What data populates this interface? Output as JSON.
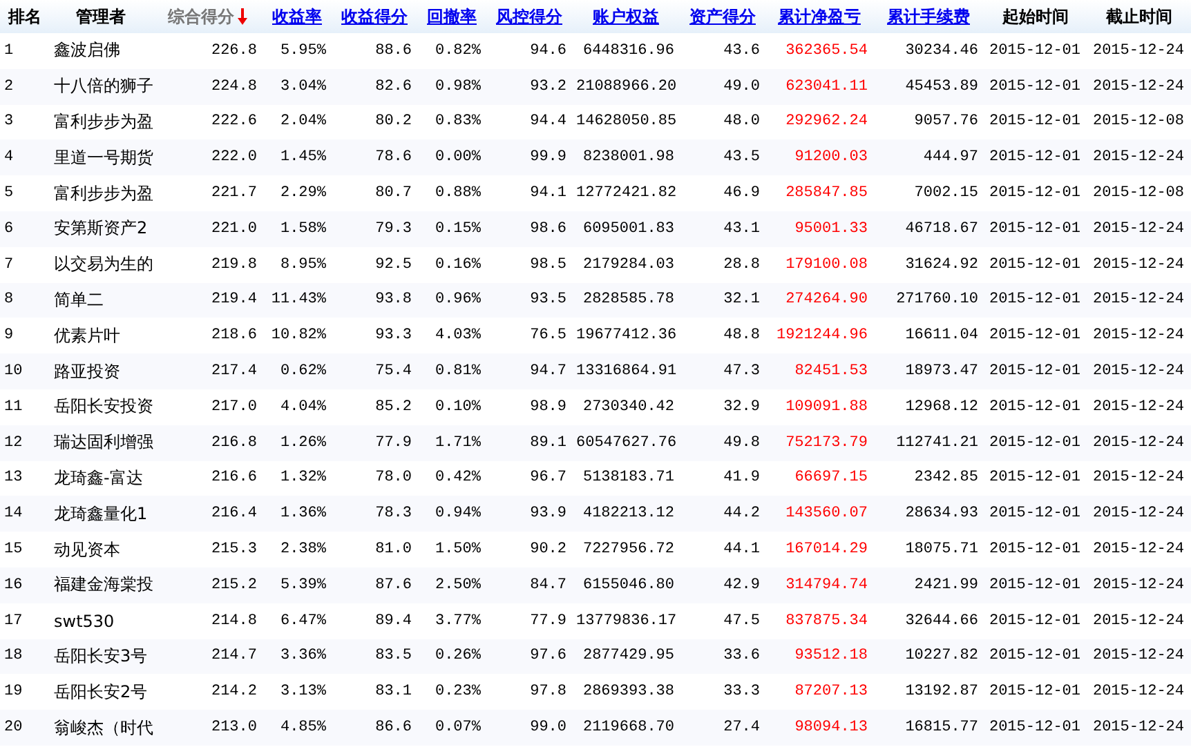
{
  "table": {
    "columns": [
      {
        "label": "排名",
        "kind": "plain"
      },
      {
        "label": "管理者",
        "kind": "plain"
      },
      {
        "label": "综合得分",
        "kind": "sorted"
      },
      {
        "label": "收益率",
        "kind": "link"
      },
      {
        "label": "收益得分",
        "kind": "link"
      },
      {
        "label": "回撤率",
        "kind": "link"
      },
      {
        "label": "风控得分",
        "kind": "link"
      },
      {
        "label": "账户权益",
        "kind": "link"
      },
      {
        "label": "资产得分",
        "kind": "link"
      },
      {
        "label": "累计净盈亏",
        "kind": "link",
        "color": "#ff0000"
      },
      {
        "label": "累计手续费",
        "kind": "link"
      },
      {
        "label": "起始时间",
        "kind": "plain"
      },
      {
        "label": "截止时间",
        "kind": "plain"
      }
    ],
    "rows": [
      [
        "1",
        "鑫波启佛",
        "226.8",
        "5.95%",
        "88.6",
        "0.82%",
        "94.6",
        "6448316.96",
        "43.6",
        "362365.54",
        "30234.46",
        "2015-12-01",
        "2015-12-24"
      ],
      [
        "2",
        "十八倍的狮子",
        "224.8",
        "3.04%",
        "82.6",
        "0.98%",
        "93.2",
        "21088966.20",
        "49.0",
        "623041.11",
        "45453.89",
        "2015-12-01",
        "2015-12-24"
      ],
      [
        "3",
        "富利步步为盈",
        "222.6",
        "2.04%",
        "80.2",
        "0.83%",
        "94.4",
        "14628050.85",
        "48.0",
        "292962.24",
        "9057.76",
        "2015-12-01",
        "2015-12-08"
      ],
      [
        "4",
        "里道一号期货",
        "222.0",
        "1.45%",
        "78.6",
        "0.00%",
        "99.9",
        "8238001.98",
        "43.5",
        "91200.03",
        "444.97",
        "2015-12-01",
        "2015-12-24"
      ],
      [
        "5",
        "富利步步为盈",
        "221.7",
        "2.29%",
        "80.7",
        "0.88%",
        "94.1",
        "12772421.82",
        "46.9",
        "285847.85",
        "7002.15",
        "2015-12-01",
        "2015-12-08"
      ],
      [
        "6",
        "安第斯资产2",
        "221.0",
        "1.58%",
        "79.3",
        "0.15%",
        "98.6",
        "6095001.83",
        "43.1",
        "95001.33",
        "46718.67",
        "2015-12-01",
        "2015-12-24"
      ],
      [
        "7",
        "以交易为生的",
        "219.8",
        "8.95%",
        "92.5",
        "0.16%",
        "98.5",
        "2179284.03",
        "28.8",
        "179100.08",
        "31624.92",
        "2015-12-01",
        "2015-12-24"
      ],
      [
        "8",
        "简单二",
        "219.4",
        "11.43%",
        "93.8",
        "0.96%",
        "93.5",
        "2828585.78",
        "32.1",
        "274264.90",
        "271760.10",
        "2015-12-01",
        "2015-12-24"
      ],
      [
        "9",
        "优素片叶",
        "218.6",
        "10.82%",
        "93.3",
        "4.03%",
        "76.5",
        "19677412.36",
        "48.8",
        "1921244.96",
        "16611.04",
        "2015-12-01",
        "2015-12-24"
      ],
      [
        "10",
        "路亚投资",
        "217.4",
        "0.62%",
        "75.4",
        "0.81%",
        "94.7",
        "13316864.91",
        "47.3",
        "82451.53",
        "18973.47",
        "2015-12-01",
        "2015-12-24"
      ],
      [
        "11",
        "岳阳长安投资",
        "217.0",
        "4.04%",
        "85.2",
        "0.10%",
        "98.9",
        "2730340.42",
        "32.9",
        "109091.88",
        "12968.12",
        "2015-12-01",
        "2015-12-24"
      ],
      [
        "12",
        "瑞达固利增强",
        "216.8",
        "1.26%",
        "77.9",
        "1.71%",
        "89.1",
        "60547627.76",
        "49.8",
        "752173.79",
        "112741.21",
        "2015-12-01",
        "2015-12-24"
      ],
      [
        "13",
        "龙琦鑫-富达",
        "216.6",
        "1.32%",
        "78.0",
        "0.42%",
        "96.7",
        "5138183.71",
        "41.9",
        "66697.15",
        "2342.85",
        "2015-12-01",
        "2015-12-24"
      ],
      [
        "14",
        "龙琦鑫量化1",
        "216.4",
        "1.36%",
        "78.3",
        "0.94%",
        "93.9",
        "4182213.12",
        "44.2",
        "143560.07",
        "28634.93",
        "2015-12-01",
        "2015-12-24"
      ],
      [
        "15",
        "动见资本",
        "215.3",
        "2.38%",
        "81.0",
        "1.50%",
        "90.2",
        "7227956.72",
        "44.1",
        "167014.29",
        "18075.71",
        "2015-12-01",
        "2015-12-24"
      ],
      [
        "16",
        "福建金海棠投",
        "215.2",
        "5.39%",
        "87.6",
        "2.50%",
        "84.7",
        "6155046.80",
        "42.9",
        "314794.74",
        "2421.99",
        "2015-12-01",
        "2015-12-24"
      ],
      [
        "17",
        "swt530",
        "214.8",
        "6.47%",
        "89.4",
        "3.77%",
        "77.9",
        "13779836.17",
        "47.5",
        "837875.34",
        "32644.66",
        "2015-12-01",
        "2015-12-24"
      ],
      [
        "18",
        "岳阳长安3号",
        "214.7",
        "3.36%",
        "83.5",
        "0.26%",
        "97.6",
        "2877429.95",
        "33.6",
        "93512.18",
        "10227.82",
        "2015-12-01",
        "2015-12-24"
      ],
      [
        "19",
        "岳阳长安2号",
        "214.2",
        "3.13%",
        "83.1",
        "0.23%",
        "97.8",
        "2869393.38",
        "33.3",
        "87207.13",
        "13192.87",
        "2015-12-01",
        "2015-12-24"
      ],
      [
        "20",
        "翁峻杰（时代",
        "213.0",
        "4.85%",
        "86.6",
        "0.07%",
        "99.0",
        "2119668.70",
        "27.4",
        "98094.13",
        "16815.77",
        "2015-12-01",
        "2015-12-24"
      ]
    ]
  }
}
